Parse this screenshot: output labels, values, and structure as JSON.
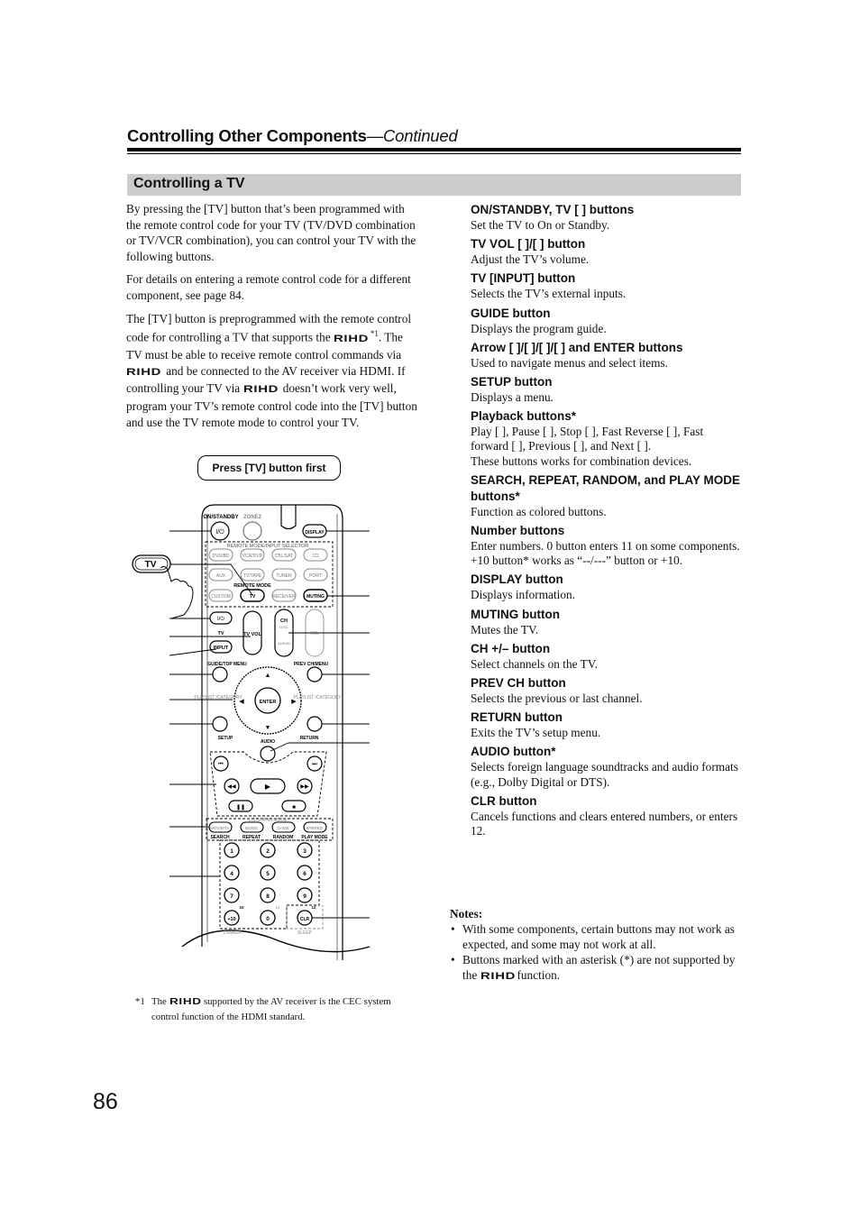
{
  "header": {
    "title": "Controlling Other Components",
    "continued": "—Continued"
  },
  "section": {
    "title": "Controlling a TV"
  },
  "intro": {
    "p1": "By pressing the [TV] button that’s been programmed with the remote control code for your TV (TV/DVD combination or TV/VCR combination), you can control your TV with the following buttons.",
    "p2": "For details on entering a remote control code for a different component, see page 84.",
    "p3_a": "The [TV] button is preprogrammed with the remote control code for controlling a TV that supports the",
    "p3_sup": "*1",
    "p3_b": ". The TV must be able to receive remote control commands via",
    "p3_c": "and be connected to the AV receiver via HDMI. If controlling your TV via",
    "p3_d": "doesn’t work very well, program your TV’s remote control code into the [TV] button and use the TV remote mode to control your TV.",
    "logo": "RIHD"
  },
  "figure": {
    "callout": "Press [TV] button first",
    "hand_label": "TV",
    "labels": {
      "on_standby": "ON/STANDBY",
      "zone2": "ZONE2",
      "display": "DISPLAY",
      "remote_mode_input": "REMOTE MODE/INPUT SELECTOR",
      "dvd": "DVD/BD",
      "vcr": "VCR/DVR",
      "cbl": "CBL/SAT",
      "cd": "CD",
      "aux": "AUX",
      "tape": "TV/TAPE",
      "tuner": "TUNER",
      "port": "PORT",
      "remote_mode": "REMOTE MODE",
      "custom": "CUSTOM",
      "tv": "TV",
      "receiver": "RECEIVER",
      "muting": "MUTING",
      "tv_small": "TV",
      "input": "INPUT",
      "tv_vol": "TV VOL",
      "ch": "CH",
      "disc": "DISC",
      "album": "ALBUM",
      "vol": "VOL",
      "guide": "GUIDE/TOP MENU",
      "prev_ch": "PREV CH/MENU",
      "playlist_l": "PLAYLIST /CATEGORY",
      "playlist_r": "PLAYLIST /CATEGORY",
      "enter": "ENTER",
      "setup": "SETUP",
      "return": "RETURN",
      "audio": "AUDIO",
      "listening_mode": "LISTENING MODE",
      "movie": "MOVIE/TV",
      "music": "MUSIC",
      "game": "GAME",
      "stereo": "STEREO",
      "search": "SEARCH",
      "repeat": "REPEAT",
      "random": "RANDOM",
      "play_mode": "PLAY MODE",
      "n1": "1",
      "n2": "2",
      "n3": "3",
      "n4": "4",
      "n5": "5",
      "n6": "6",
      "n7": "7",
      "n8": "8",
      "n9": "9",
      "plus10": "+10",
      "n0": "0",
      "clr": "CLR",
      "ten": "10",
      "eleven": "11",
      "twelve": "12",
      "dimmer": "DIMMER",
      "sleep": "SLEEP"
    }
  },
  "buttons": [
    {
      "title": "ON/STANDBY, TV [     ] buttons",
      "desc": "Set the TV to On or Standby."
    },
    {
      "title": "TV VOL [   ]/[   ] button",
      "desc": "Adjust the TV’s volume."
    },
    {
      "title": "TV [INPUT] button",
      "desc": "Selects the TV’s external inputs."
    },
    {
      "title": "GUIDE button",
      "desc": "Displays the program guide."
    },
    {
      "title": "Arrow [   ]/[   ]/[    ]/[    ] and ENTER buttons",
      "desc": "Used to navigate menus and select items."
    },
    {
      "title": "SETUP button",
      "desc": "Displays a menu."
    },
    {
      "title": "Playback buttons*",
      "desc": "Play [      ], Pause [    ], Stop [    ], Fast Reverse [        ], Fast forward [        ], Previous [        ], and Next [        ].",
      "desc2": "These buttons works for combination devices."
    },
    {
      "title": "SEARCH, REPEAT, RANDOM, and PLAY MODE buttons*",
      "desc": "Function as colored buttons."
    },
    {
      "title": "Number buttons",
      "desc": "Enter numbers. 0 button enters 11 on some components. +10 button* works as “--/---” button or +10."
    },
    {
      "title": "DISPLAY button",
      "desc": "Displays information."
    },
    {
      "title": "MUTING button",
      "desc": "Mutes the TV."
    },
    {
      "title": "CH +/– button",
      "desc": "Select channels on the TV."
    },
    {
      "title": "PREV CH button",
      "desc": "Selects the previous or last channel."
    },
    {
      "title": "RETURN button",
      "desc": "Exits the TV’s setup menu."
    },
    {
      "title": "AUDIO button*",
      "desc": "Selects foreign language soundtracks and audio formats (e.g., Dolby Digital or DTS)."
    },
    {
      "title": "CLR button",
      "desc": "Cancels functions and clears entered numbers, or enters 12."
    }
  ],
  "notes": {
    "title": "Notes:",
    "items": [
      "With some components, certain buttons may not work as expected, and some may not work at all.",
      "Buttons marked with an asterisk (*) are not supported by the"
    ],
    "item2_end": "function."
  },
  "footnote": {
    "marker": "*1",
    "a": "The",
    "b": "supported by the AV receiver is the CEC system control function of the HDMI standard."
  },
  "page_number": "86"
}
